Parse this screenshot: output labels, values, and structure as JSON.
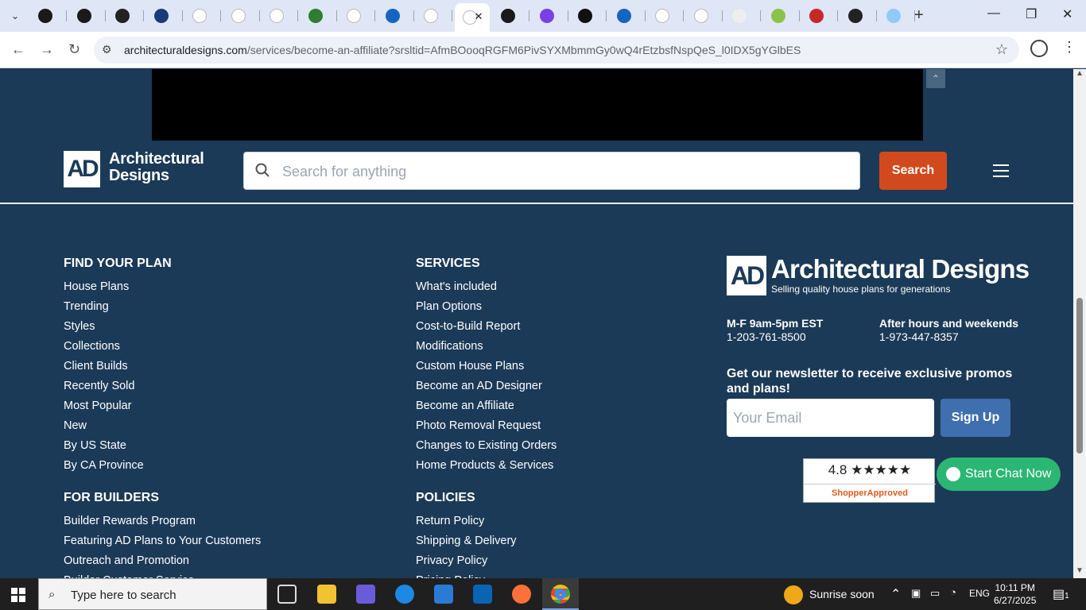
{
  "browser": {
    "tabs": [
      {
        "favicon": "chatgpt-icon",
        "color": "#1a1a1a"
      },
      {
        "favicon": "chatgpt-icon",
        "color": "#1a1a1a"
      },
      {
        "favicon": "robot-icon",
        "color": "#222222"
      },
      {
        "favicon": "ttp-icon",
        "color": "#1a3a7a"
      },
      {
        "favicon": "google-icon",
        "color": "#ffffff"
      },
      {
        "favicon": "google-icon",
        "color": "#ffffff"
      },
      {
        "favicon": "google-icon",
        "color": "#ffffff"
      },
      {
        "favicon": "globe-icon",
        "color": "#2e7d32"
      },
      {
        "favicon": "google-icon",
        "color": "#ffffff"
      },
      {
        "favicon": "xf-icon",
        "color": "#1565c0"
      },
      {
        "favicon": "google-icon",
        "color": "#ffffff"
      },
      {
        "favicon": "active-tab-icon",
        "color": "#ffffff",
        "active": true
      },
      {
        "favicon": "threads-icon",
        "color": "#1a1a1a"
      },
      {
        "favicon": "p-icon",
        "color": "#7b3fe4"
      },
      {
        "favicon": "d-icon",
        "color": "#111111"
      },
      {
        "favicon": "b-icon",
        "color": "#1565c0"
      },
      {
        "favicon": "google-icon",
        "color": "#ffffff"
      },
      {
        "favicon": "google-icon",
        "color": "#ffffff"
      },
      {
        "favicon": "doc-icon",
        "color": "#eeeeee"
      },
      {
        "favicon": "grammarly-icon",
        "color": "#8bc34a"
      },
      {
        "favicon": "fb-icon",
        "color": "#c62828"
      },
      {
        "favicon": "car-icon",
        "color": "#222222"
      },
      {
        "favicon": "pen-icon",
        "color": "#90caf9"
      }
    ],
    "url_host": "architecturaldesigns.com",
    "url_path": "/services/become-an-affiliate?srsltid=AfmBOooqRGFM6PivSYXMbmmGy0wQ4rEtzbsfNspQeS_l0IDX5gYGlbES"
  },
  "header": {
    "logo_mark": "AD",
    "logo_line1": "Architectural",
    "logo_line2": "Designs",
    "search_placeholder": "Search for anything",
    "search_button": "Search"
  },
  "footer": {
    "find_your_plan": {
      "title": "FIND YOUR PLAN",
      "items": [
        "House Plans",
        "Trending",
        "Styles",
        "Collections",
        "Client Builds",
        "Recently Sold",
        "Most Popular",
        "New",
        "By US State",
        "By CA Province"
      ]
    },
    "services": {
      "title": "SERVICES",
      "items": [
        "What's included",
        "Plan Options",
        "Cost-to-Build Report",
        "Modifications",
        "Custom House Plans",
        "Become an AD Designer",
        "Become an Affiliate",
        "Photo Removal Request",
        "Changes to Existing Orders",
        "Home Products & Services"
      ]
    },
    "for_builders": {
      "title": "FOR BUILDERS",
      "items": [
        "Builder Rewards Program",
        "Featuring AD Plans to Your Customers",
        "Outreach and Promotion",
        "Builder Customer Service"
      ]
    },
    "policies": {
      "title": "POLICIES",
      "items": [
        "Return Policy",
        "Shipping & Delivery",
        "Privacy Policy",
        "Pricing Policy"
      ]
    },
    "brand": {
      "mark": "AD",
      "name": "Architectural Designs",
      "tagline": "Selling quality house plans for generations"
    },
    "hours": [
      {
        "label": "M-F 9am-5pm EST",
        "phone": "1-203-761-8500"
      },
      {
        "label": "After hours and weekends",
        "phone": "1-973-447-8357"
      }
    ],
    "newsletter": {
      "title": "Get our newsletter to receive exclusive promos and plans!",
      "email_placeholder": "Your Email",
      "button": "Sign Up"
    },
    "rating": {
      "score": "4.8",
      "stars": "★★★★★",
      "brand": "ShopperApproved"
    },
    "chat_button": "Start Chat Now"
  },
  "taskbar": {
    "search_placeholder": "Type here to search",
    "weather": "Sunrise soon",
    "language": "ENG",
    "time": "10:11 PM",
    "date": "6/27/2025",
    "notification_count": "1"
  }
}
